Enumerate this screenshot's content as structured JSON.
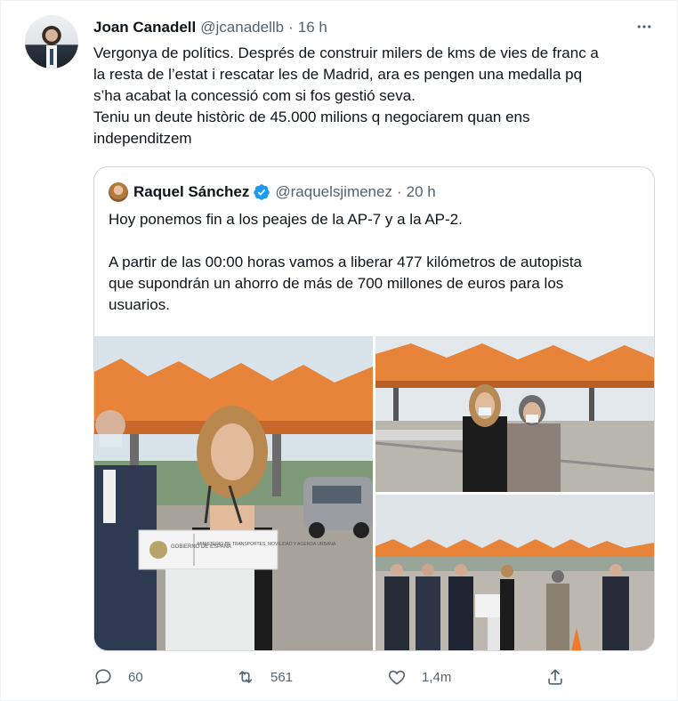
{
  "tweet": {
    "author_name": "Joan Canadell",
    "author_handle": "@jcanadellb",
    "separator": "·",
    "time": "16 h",
    "lines": [
      "Vergonya de polítics. Després de construir milers de kms de vies de franc a",
      "la resta de l’estat i rescatar les de Madrid, ara es pengen una medalla pq",
      "s’ha acabat la concessió com si fos gestió seva.",
      "Teniu un deute històric de 45.000 milions q negociarem quan ens",
      "independitzem"
    ]
  },
  "quoted": {
    "author_name": "Raquel Sánchez",
    "author_handle": "@raquelsjimenez",
    "separator": "·",
    "time": "20 h",
    "verified": true,
    "paragraph_1": "Hoy ponemos fin a los peajes de la AP-7 y a la AP-2.",
    "paragraph_2_lines": [
      "A partir de las 00:00 horas vamos a liberar 477 kilómetros de autopista",
      "que supondrán un ahorro de más de 700 millones de euros para los",
      "usuarios."
    ],
    "lectern_sign": {
      "left": "GOBIERNO DE ESPAÑA",
      "right": "MINISTERIO DE TRANSPORTES, MOVILIDAD Y AGENDA URBANA"
    }
  },
  "actions": {
    "reply_count": "60",
    "retweet_count": "561",
    "like_count": "1,4m"
  },
  "colors": {
    "text": "#0f1419",
    "secondary": "#536471",
    "border": "#cfd9de",
    "verified": "#1d9bf0",
    "toll_canopy": "#e8843a"
  },
  "icons": [
    "more-icon",
    "verified-icon",
    "reply-icon",
    "retweet-icon",
    "like-icon",
    "share-icon"
  ]
}
